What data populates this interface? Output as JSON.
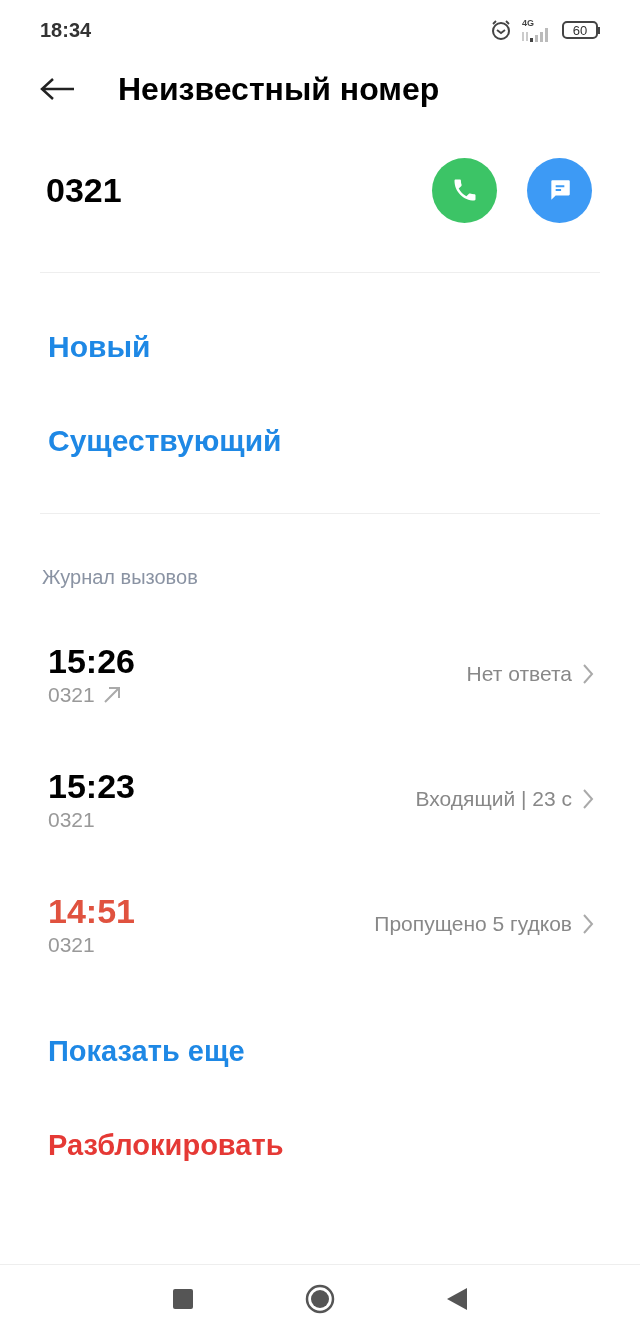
{
  "status_bar": {
    "time": "18:34",
    "network": "4G",
    "battery": "60"
  },
  "header": {
    "title": "Неизвестный номер"
  },
  "contact": {
    "number": "0321"
  },
  "add_options": [
    {
      "label": "Новый"
    },
    {
      "label": "Существующий"
    }
  ],
  "call_log": {
    "title": "Журнал вызовов",
    "calls": [
      {
        "time": "15:26",
        "number": "0321",
        "kind": "outgoing",
        "status": "Нет ответа"
      },
      {
        "time": "15:23",
        "number": "0321",
        "kind": "incoming",
        "status": "Входящий | 23 с"
      },
      {
        "time": "14:51",
        "number": "0321",
        "kind": "missed",
        "status": "Пропущено 5 гудков"
      }
    ]
  },
  "show_more": "Показать еще",
  "unblock": "Разблокировать"
}
